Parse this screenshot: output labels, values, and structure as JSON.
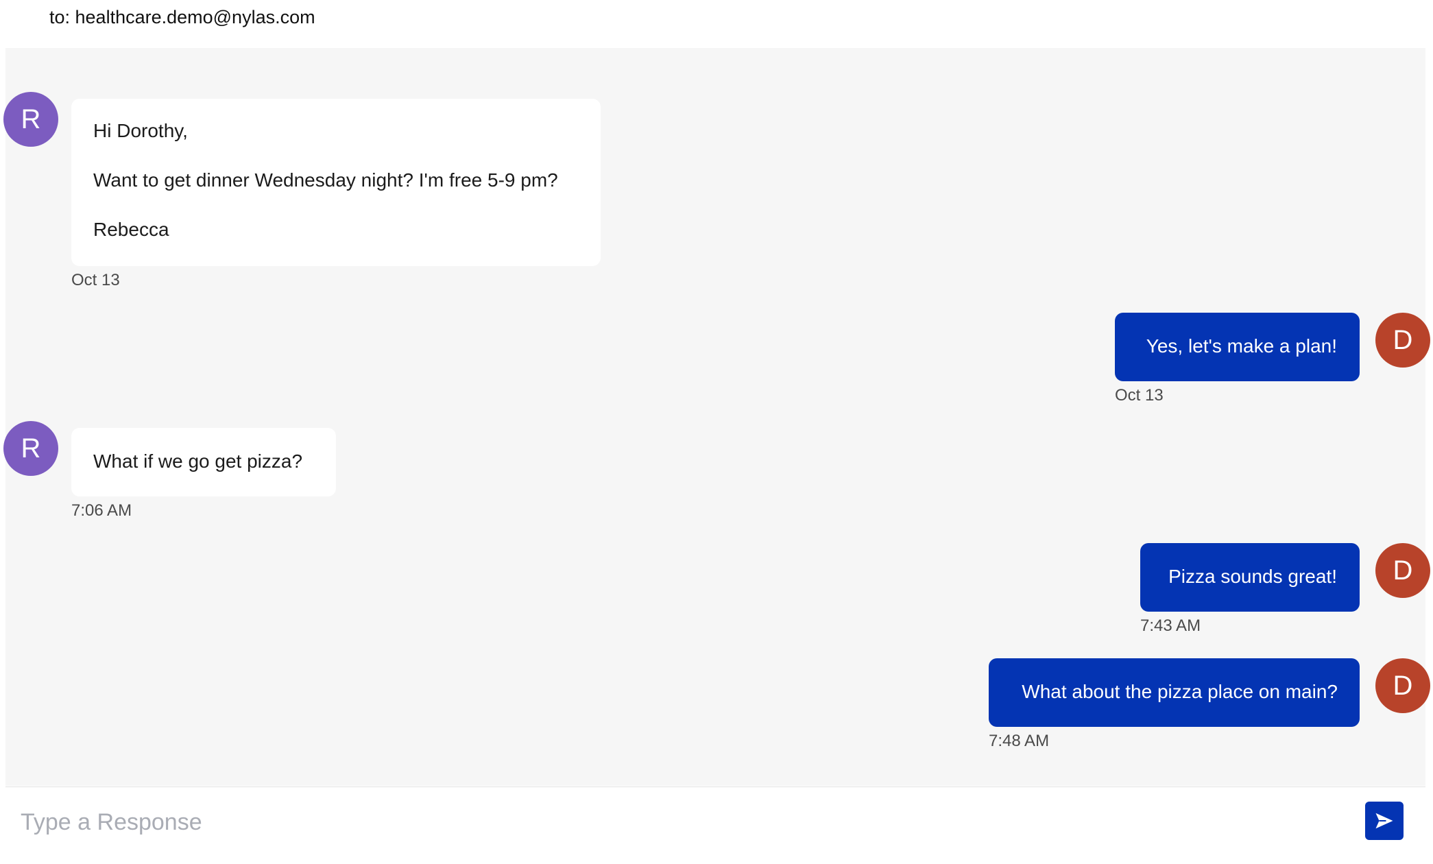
{
  "header": {
    "to_text": "to: healthcare.demo@nylas.com"
  },
  "colors": {
    "incoming_avatar": "#7c5cc0",
    "outgoing_avatar": "#b8432a",
    "outgoing_bubble": "#0434b3",
    "thread_background": "#f6f6f6"
  },
  "messages": [
    {
      "direction": "incoming",
      "avatar_initial": "R",
      "lines": [
        "Hi Dorothy,",
        "Want to get dinner Wednesday night? I'm free 5-9 pm?",
        "Rebecca"
      ],
      "timestamp": "Oct 13"
    },
    {
      "direction": "outgoing",
      "avatar_initial": "D",
      "lines": [
        "Yes, let's make a plan!"
      ],
      "timestamp": "Oct 13"
    },
    {
      "direction": "incoming",
      "avatar_initial": "R",
      "lines": [
        "What if we go get pizza?"
      ],
      "timestamp": "7:06 AM"
    },
    {
      "direction": "outgoing",
      "avatar_initial": "D",
      "lines": [
        "Pizza sounds great!"
      ],
      "timestamp": "7:43 AM"
    },
    {
      "direction": "outgoing",
      "avatar_initial": "D",
      "lines": [
        "What about the pizza place on main?"
      ],
      "timestamp": "7:48 AM"
    }
  ],
  "composer": {
    "placeholder": "Type a Response",
    "value": "",
    "send_icon": "send-arrow-icon"
  }
}
